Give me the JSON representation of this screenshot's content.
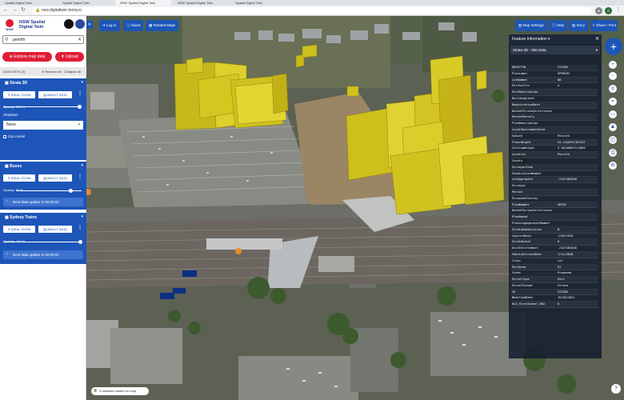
{
  "browser": {
    "tabs": [
      "Spatial Digital Twin",
      "Spatial Digital Twin",
      "NSW Spatial Digital Twin",
      "NSW Spatial Digital Twin",
      "Spatial Digital Twin"
    ],
    "url": "nsw.digitaltwin.terria.io"
  },
  "sidebar": {
    "logo_title_line1": "NSW Spatial",
    "logo_title_line2": "Digital Twin",
    "search_value": "penrith",
    "explore_label": "Explore map data",
    "upload_label": "Upload",
    "datasets_label": "DATA SETS (3)",
    "remove_all": "Remove All",
    "collapse_all": "Collapse All",
    "panels": [
      {
        "title": "Strata 3D",
        "ideal_zoom": "IDEAL ZOOM",
        "about": "ABOUT DATA",
        "opacity": "Opacity: 100 %",
        "opacity_value": 1.0,
        "shadows_label": "Shadows",
        "shadows_value": "None",
        "clip_label": "Clip model"
      },
      {
        "title": "Buses",
        "ideal_zoom": "IDEAL ZOOM",
        "about": "ABOUT DATA",
        "opacity": "Opacity: 80 %",
        "opacity_value": 0.8,
        "next_update": "Next data update in 00:00:02"
      },
      {
        "title": "Sydney Trains",
        "ideal_zoom": "IDEAL ZOOM",
        "about": "ABOUT DATA",
        "opacity": "Opacity: 100 %",
        "opacity_value": 1.0,
        "next_update": "Next data update in 00:00:02"
      }
    ]
  },
  "map_toolbar": {
    "login": "Log In",
    "about": "About",
    "related": "Related Maps",
    "settings": "Map Settings",
    "help": "Help",
    "story": "Story",
    "share": "Share / Print"
  },
  "feature_panel": {
    "title": "Feature Information",
    "layer": "Strata 3D - Site Data",
    "rows": [
      [
        "OBJECTID",
        "372282"
      ],
      [
        "PlanLabel",
        "SP98292"
      ],
      [
        "LotNumber",
        "80"
      ],
      [
        "PartSuffix",
        "A"
      ],
      [
        "PartDescription",
        ""
      ],
      [
        "BuildingLevel",
        ""
      ],
      [
        "RegistrationDate",
        ""
      ],
      [
        "DateOfStrataCertificate",
        ""
      ],
      [
        "ParentParcels",
        ""
      ],
      [
        "PlanDescription",
        ""
      ],
      [
        "LocalGovernmentArea",
        ""
      ],
      [
        "Suburb",
        "Penrith"
      ],
      [
        "FloorHeight",
        "54.1445291307237"
      ],
      [
        "CeilingHeight",
        "3.36240891141805"
      ],
      [
        "Locality",
        "Penrith"
      ],
      [
        "County",
        ""
      ],
      [
        "SurveyorView",
        ""
      ],
      [
        "SubdivisionNumber",
        ""
      ],
      [
        "LotAggregate",
        "-2147483648"
      ],
      [
        "Surveyor",
        ""
      ],
      [
        "Parish",
        ""
      ],
      [
        "PurposeOfSurvey",
        ""
      ],
      [
        "PlanNumber",
        "98292"
      ],
      [
        "DateOfSurveyCertificate",
        ""
      ],
      [
        "PlanOwned",
        ""
      ],
      [
        "PlanningApprovalNumber",
        ""
      ],
      [
        "StrataSubdivision",
        "N"
      ],
      [
        "CaptureDate",
        "1/09/2018"
      ],
      [
        "StrataLevel",
        "8"
      ],
      [
        "UnitEntitlement",
        "-2147483648"
      ],
      [
        "FabricExtractDate",
        "7/11/2018"
      ],
      [
        "Class",
        "Lot"
      ],
      [
        "PartArea",
        "91"
      ],
      [
        "State",
        "Proposed"
      ],
      [
        "ParcelType",
        "Part"
      ],
      [
        "ParcelFormat",
        "Strata"
      ],
      [
        "Id",
        "372282"
      ],
      [
        "ModifiedDate",
        "19/05/2021"
      ],
      [
        "OLD_StrataLevel_MAX",
        "8"
      ]
    ]
  },
  "status": {
    "datasets_loaded": "3 datasets loaded on map"
  },
  "colors": {
    "brand_blue": "#1d55b8",
    "accent_red": "#e01e37",
    "building_yellow": "#d4c21a"
  }
}
